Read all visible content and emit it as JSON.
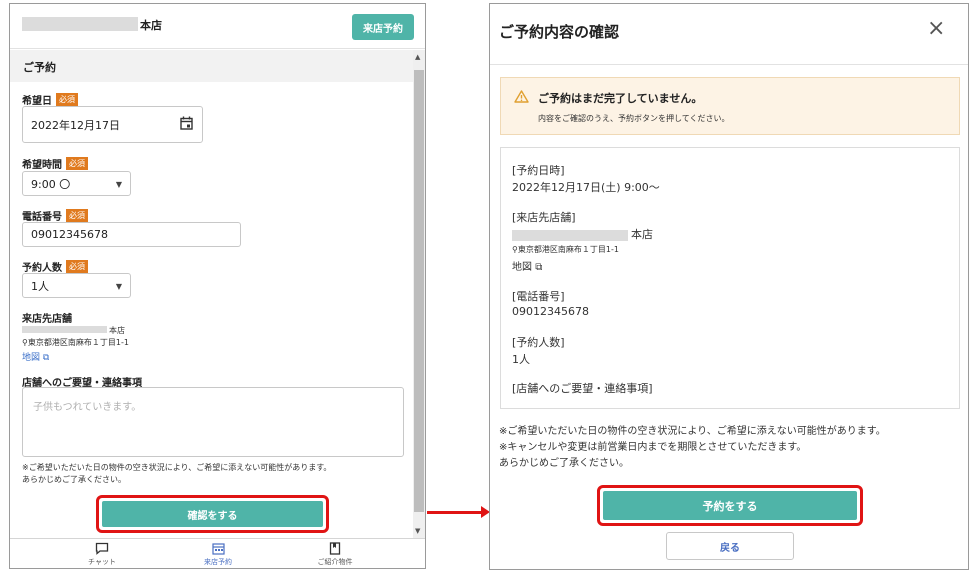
{
  "left": {
    "store_name": "本店",
    "visit_button": "来店予約",
    "section_title": "ご予約",
    "date_label": "希望日",
    "required_badge": "必須",
    "date_value": "2022年12月17日",
    "time_label": "希望時間",
    "time_value": "9:00 〇",
    "phone_label": "電話番号",
    "phone_value": "09012345678",
    "people_label": "予約人数",
    "people_value": "1人",
    "shop_label": "来店先店舗",
    "shop_name": "本店",
    "shop_address": "⚲東京都港区南麻布１丁目1-1",
    "map_link": "地図",
    "request_label": "店舗へのご要望・連絡事項",
    "request_placeholder": "子供もつれていきます。",
    "note_line1": "※ご希望いただいた日の物件の空き状況により、ご希望に添えない可能性があります。",
    "note_line2": "あらかじめご了承ください。",
    "confirm_button": "確認をする",
    "nav": [
      {
        "label": "チャット",
        "icon": "chat-icon"
      },
      {
        "label": "来店予約",
        "icon": "calendar-icon"
      },
      {
        "label": "ご紹介物件",
        "icon": "bookmark-icon"
      }
    ]
  },
  "right": {
    "title": "ご予約内容の確認",
    "close": "×",
    "warning_title": "ご予約はまだ完了していません。",
    "warning_text": "内容をご確認のうえ、予約ボタンを押してください。",
    "date_heading": "[予約日時]",
    "date_value": "2022年12月17日(土) 9:00〜",
    "shop_heading": "[来店先店舗]",
    "shop_name": "本店",
    "shop_address": "⚲東京都港区南麻布１丁目1-1",
    "map_link": "地図",
    "phone_heading": "[電話番号]",
    "phone_value": "09012345678",
    "people_heading": "[予約人数]",
    "people_value": "1人",
    "request_heading": "[店舗へのご要望・連絡事項]",
    "note1": "※ご希望いただいた日の物件の空き状況により、ご希望に添えない可能性があります。",
    "note2": "※キャンセルや変更は前営業日内までを期限とさせていただきます。",
    "note3": "あらかじめご了承ください。",
    "book_button": "予約をする",
    "back_button": "戻る"
  },
  "colors": {
    "accent": "#4fb4a8",
    "highlight": "#e01414",
    "badge": "#e07a1e",
    "link": "#3a6fc9"
  }
}
